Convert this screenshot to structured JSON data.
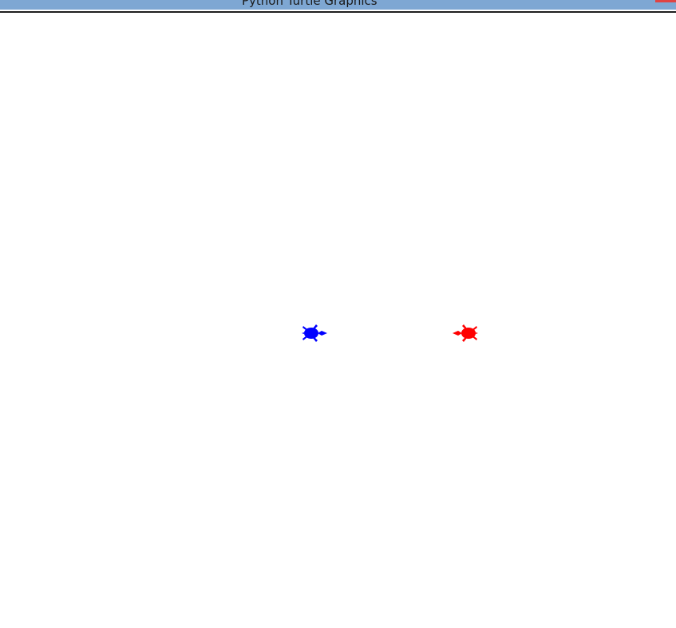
{
  "window": {
    "title": "Python Turtle Graphics",
    "titlebar_color": "#7ea7d3",
    "close_button_color": "#e04343",
    "canvas_color": "#ffffff"
  },
  "turtles": [
    {
      "name": "blue-turtle",
      "color": "#0000ff",
      "heading": "east",
      "shape": "turtle"
    },
    {
      "name": "red-turtle",
      "color": "#ff0000",
      "heading": "west",
      "shape": "turtle"
    }
  ]
}
